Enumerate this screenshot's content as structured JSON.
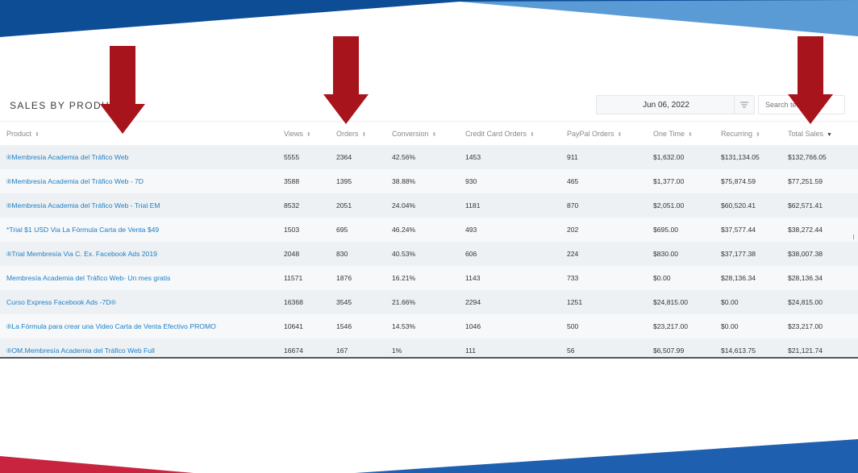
{
  "panel": {
    "title": "SALES BY PRODUCT",
    "date": "Jun 06, 2022",
    "search_placeholder": "Search te"
  },
  "columns": [
    "Product",
    "Views",
    "Orders",
    "Conversion",
    "Credit Card Orders",
    "PayPal Orders",
    "One Time",
    "Recurring",
    "Total Sales"
  ],
  "rows": [
    [
      "®Membresía Academia del Tráfico Web",
      "5555",
      "2364",
      "42.56%",
      "1453",
      "911",
      "$1,632.00",
      "$131,134.05",
      "$132,766.05"
    ],
    [
      "®Membresía Academia del Tráfico Web - 7D",
      "3588",
      "1395",
      "38.88%",
      "930",
      "465",
      "$1,377.00",
      "$75,874.59",
      "$77,251.59"
    ],
    [
      "®Membresía Academia del Tráfico Web - Trial EM",
      "8532",
      "2051",
      "24.04%",
      "1181",
      "870",
      "$2,051.00",
      "$60,520.41",
      "$62,571.41"
    ],
    [
      "*Trial $1 USD Via La Fórmula Carta de Venta $49",
      "1503",
      "695",
      "46.24%",
      "493",
      "202",
      "$695.00",
      "$37,577.44",
      "$38,272.44"
    ],
    [
      "®Trial Membresía Via C. Ex. Facebook Ads 2019",
      "2048",
      "830",
      "40.53%",
      "606",
      "224",
      "$830.00",
      "$37,177.38",
      "$38,007.38"
    ],
    [
      "Membresía Academia del Tráfico Web- Un mes gratis",
      "11571",
      "1876",
      "16.21%",
      "1143",
      "733",
      "$0.00",
      "$28,136.34",
      "$28,136.34"
    ],
    [
      "Curso Express Facebook Ads -7D®",
      "16368",
      "3545",
      "21.66%",
      "2294",
      "1251",
      "$24,815.00",
      "$0.00",
      "$24,815.00"
    ],
    [
      "®La Fórmula para crear una Video Carta de Venta Efectivo PROMO",
      "10641",
      "1546",
      "14.53%",
      "1046",
      "500",
      "$23,217.00",
      "$0.00",
      "$23,217.00"
    ],
    [
      "®OM.Membresía Academia del Tráfico Web Full",
      "16674",
      "167",
      "1%",
      "111",
      "56",
      "$6,507.99",
      "$14,613.75",
      "$21,121.74"
    ]
  ],
  "colors": {
    "top_band_dark": "#0d4d95",
    "top_band_light": "#5b9bd5",
    "arrow": "#a8141c",
    "link": "#1d7fc4",
    "bottom_red": "#c8243f",
    "bottom_blue": "#1f5fb0"
  },
  "icons": {
    "sort": "sort-arrows-icon",
    "filter": "filter-lines-icon",
    "arrow": "down-arrow-icon"
  }
}
